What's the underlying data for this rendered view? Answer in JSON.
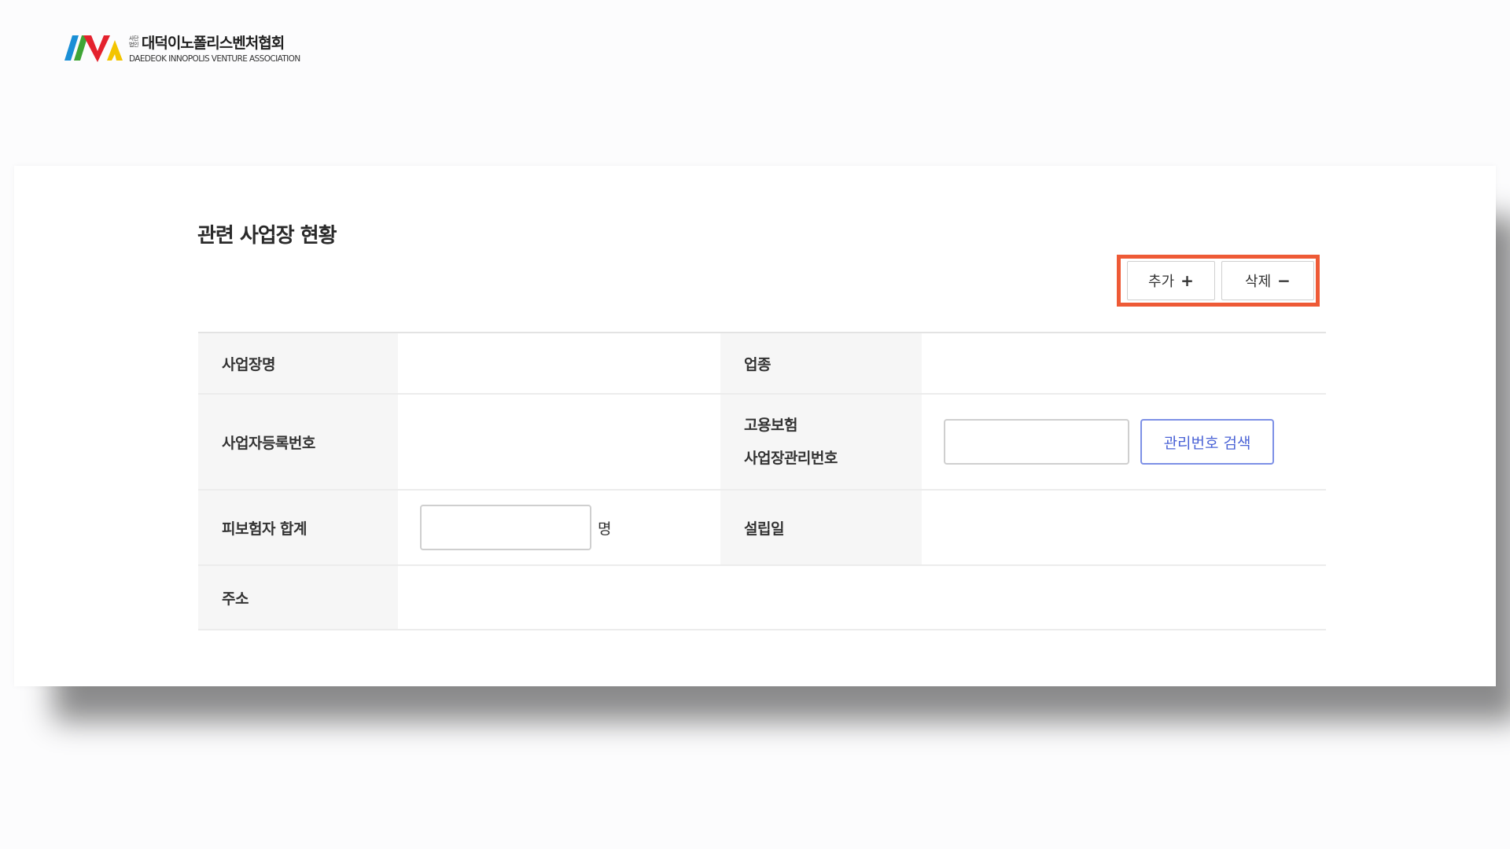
{
  "header": {
    "logo_prefix_top": "사단",
    "logo_prefix_bottom": "법인",
    "logo_kor": "대덕이노폴리스벤처협회",
    "logo_eng": "DAEDEOK INNOPOLIS VENTURE ASSOCIATION",
    "logo_colors": [
      "#1a8fd6",
      "#3fa535",
      "#e4222e",
      "#f3c400"
    ]
  },
  "section": {
    "title": "관련 사업장 현황"
  },
  "toolbar": {
    "add_label": "추가",
    "add_symbol": "+",
    "delete_label": "삭제",
    "delete_symbol": "−",
    "highlight_color": "#ee5a36"
  },
  "table": {
    "business_name_label": "사업장명",
    "business_name_value": "",
    "industry_label": "업종",
    "industry_value": "",
    "reg_number_label": "사업자등록번호",
    "reg_number_value": "",
    "ins_label_line1": "고용보험",
    "ins_label_line2": "사업장관리번호",
    "ins_input_value": "",
    "search_button_label": "관리번호 검색",
    "insured_total_label": "피보험자 합계",
    "insured_total_value": "",
    "insured_unit": "명",
    "founded_label": "설립일",
    "founded_value": "",
    "address_label": "주소",
    "address_value": ""
  }
}
